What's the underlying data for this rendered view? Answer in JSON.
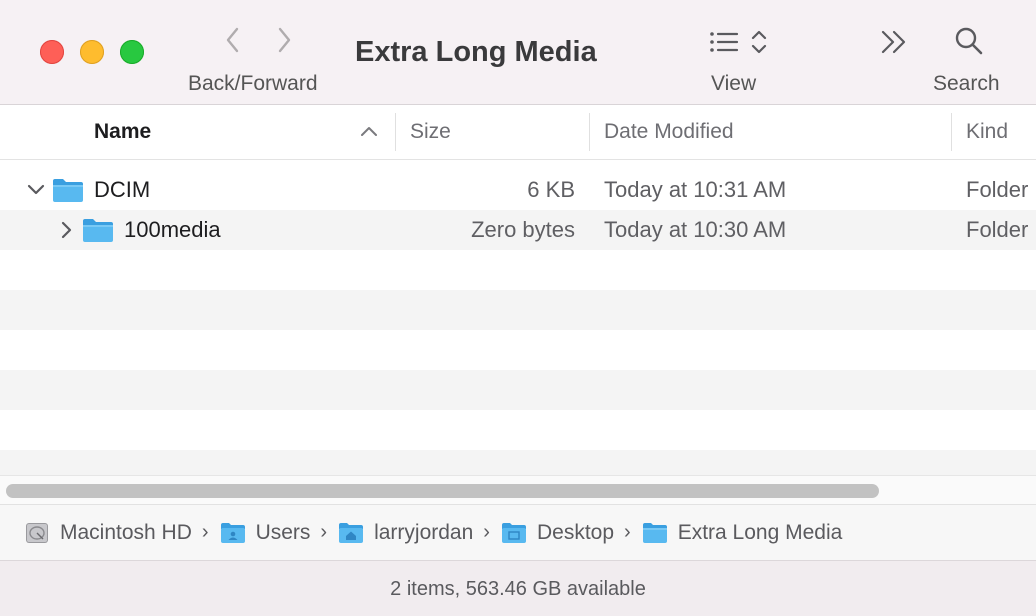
{
  "window": {
    "title": "Extra Long Media"
  },
  "toolbar": {
    "back_forward_label": "Back/Forward",
    "view_label": "View",
    "search_label": "Search",
    "icons": [
      "chevron-left-icon",
      "chevron-right-icon",
      "list-view-icon",
      "double-chevron-icon",
      "search-icon"
    ]
  },
  "columns": {
    "name": "Name",
    "size": "Size",
    "date_modified": "Date Modified",
    "kind": "Kind"
  },
  "rows": [
    {
      "name": "DCIM",
      "size": "6 KB",
      "date": "Today at 10:31 AM",
      "kind": "Folder",
      "expanded": true,
      "indent": 0
    },
    {
      "name": "100media",
      "size": "Zero bytes",
      "date": "Today at 10:30 AM",
      "kind": "Folder",
      "expanded": false,
      "indent": 1
    }
  ],
  "pathbar": [
    {
      "label": "Macintosh HD",
      "icon": "hard-drive-icon"
    },
    {
      "label": "Users",
      "icon": "users-folder-icon"
    },
    {
      "label": "larryjordan",
      "icon": "home-folder-icon"
    },
    {
      "label": "Desktop",
      "icon": "desktop-folder-icon"
    },
    {
      "label": "Extra Long Media",
      "icon": "folder-icon"
    }
  ],
  "status": {
    "text": "2 items, 563.46 GB available"
  },
  "colors": {
    "toolbar_bg": "#f6f1f4",
    "folder_blue": "#4fb3ee",
    "close_red": "#fe5f57",
    "minimize_yellow": "#febc2e",
    "zoom_green": "#28c840"
  }
}
